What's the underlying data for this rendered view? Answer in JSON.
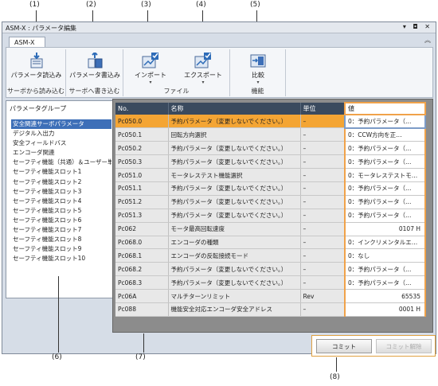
{
  "callouts": [
    "(1)",
    "(2)",
    "(3)",
    "(4)",
    "(5)",
    "(6)",
    "(7)",
    "(8)"
  ],
  "window": {
    "title": "ASM-X : パラメータ編集",
    "controls": "▾ ◘ ✕"
  },
  "doc_tab": "ASM-X",
  "ribbon": {
    "read_params": "パラメータ読込み",
    "write_params": "パラメータ書込み",
    "import": "インポート",
    "export": "エクスポート",
    "compare": "比較",
    "group_read": "サーボから読み込む",
    "group_write": "サーボへ書き込む",
    "group_file": "ファイル",
    "group_func": "機能",
    "dropdown_glyph": "▾"
  },
  "param_groups": {
    "header": "パラメータグループ",
    "items": [
      "安全関連サーボパラメータ",
      "デジタル入出力",
      "安全フィールドバス",
      "エンコーダ関連",
      "セーフティ機能（共通）＆ユーザー単位",
      "セーフティ機能スロット1",
      "セーフティ機能スロット2",
      "セーフティ機能スロット3",
      "セーフティ機能スロット4",
      "セーフティ機能スロット5",
      "セーフティ機能スロット6",
      "セーフティ機能スロット7",
      "セーフティ機能スロット8",
      "セーフティ機能スロット9",
      "セーフティ機能スロット10"
    ],
    "selected_index": 0
  },
  "grid": {
    "columns": [
      "No.",
      "名称",
      "単位",
      "値"
    ],
    "rows": [
      {
        "no": "Pc050.0",
        "name": "予約パラメータ（変更しないでください。）",
        "unit": "–",
        "value": "0：予約パラメータ（…"
      },
      {
        "no": "Pc050.1",
        "name": "回転方向選択",
        "unit": "–",
        "value": "0：CCW方向を正…"
      },
      {
        "no": "Pc050.2",
        "name": "予約パラメータ（変更しないでください。）",
        "unit": "–",
        "value": "0：予約パラメータ（…"
      },
      {
        "no": "Pc050.3",
        "name": "予約パラメータ（変更しないでください。）",
        "unit": "–",
        "value": "0：予約パラメータ（…"
      },
      {
        "no": "Pc051.0",
        "name": "モータレステスト機能選択",
        "unit": "–",
        "value": "0：モータレステストモ…"
      },
      {
        "no": "Pc051.1",
        "name": "予約パラメータ（変更しないでください。）",
        "unit": "–",
        "value": "0：予約パラメータ（…"
      },
      {
        "no": "Pc051.2",
        "name": "予約パラメータ（変更しないでください。）",
        "unit": "–",
        "value": "0：予約パラメータ（…"
      },
      {
        "no": "Pc051.3",
        "name": "予約パラメータ（変更しないでください。）",
        "unit": "–",
        "value": "0：予約パラメータ（…"
      },
      {
        "no": "Pc062",
        "name": "モータ最高回転速度",
        "unit": "–",
        "value": "0107 H"
      },
      {
        "no": "Pc068.0",
        "name": "エンコーダの種類",
        "unit": "–",
        "value": "0：インクリメンタルエ…"
      },
      {
        "no": "Pc068.1",
        "name": "エンコーダの反転接続モード",
        "unit": "–",
        "value": "0：なし"
      },
      {
        "no": "Pc068.2",
        "name": "予約パラメータ（変更しないでください。）",
        "unit": "–",
        "value": "0：予約パラメータ（…"
      },
      {
        "no": "Pc068.3",
        "name": "予約パラメータ（変更しないでください。）",
        "unit": "–",
        "value": "0：予約パラメータ（…"
      },
      {
        "no": "Pc06A",
        "name": "マルチターンリミット",
        "unit": "Rev",
        "value": "65535"
      },
      {
        "no": "Pc088",
        "name": "機能安全対応エンコーダ安全アドレス",
        "unit": "–",
        "value": "0001 H"
      }
    ],
    "selected_row": 0
  },
  "buttons": {
    "commit": "コミット",
    "revert": "コミット解除"
  }
}
